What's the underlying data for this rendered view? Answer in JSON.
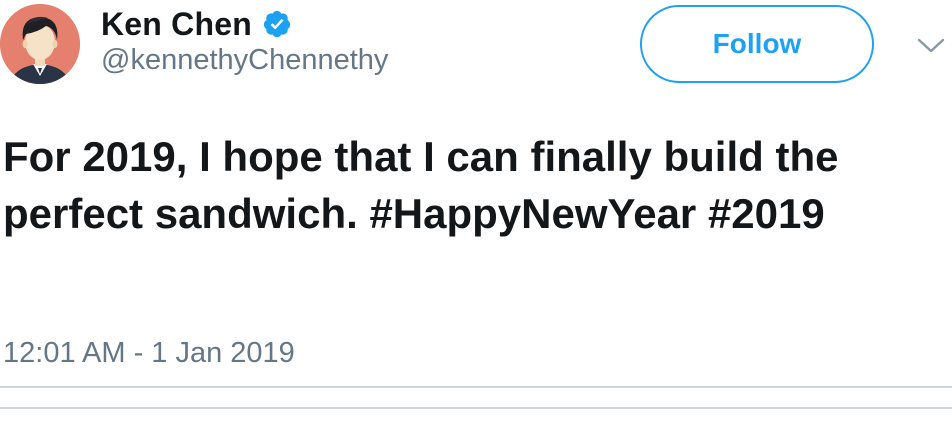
{
  "author": {
    "display_name": "Ken Chen",
    "handle": "@kennethyChennethy",
    "verified": true,
    "avatar_icon": "cartoon-person-avatar-icon"
  },
  "actions": {
    "follow_label": "Follow",
    "menu_icon": "chevron-down-icon"
  },
  "tweet": {
    "text_part1": "For 2019, I hope that I can finally build the perfect sandwich. ",
    "hashtag1": "#HappyNewYear",
    "hashtag2": "#2019",
    "timestamp": "12:01 AM - 1 Jan 2019"
  },
  "colors": {
    "accent": "#1da1f2",
    "secondary_text": "#657786",
    "avatar_bg": "#e5806e"
  }
}
